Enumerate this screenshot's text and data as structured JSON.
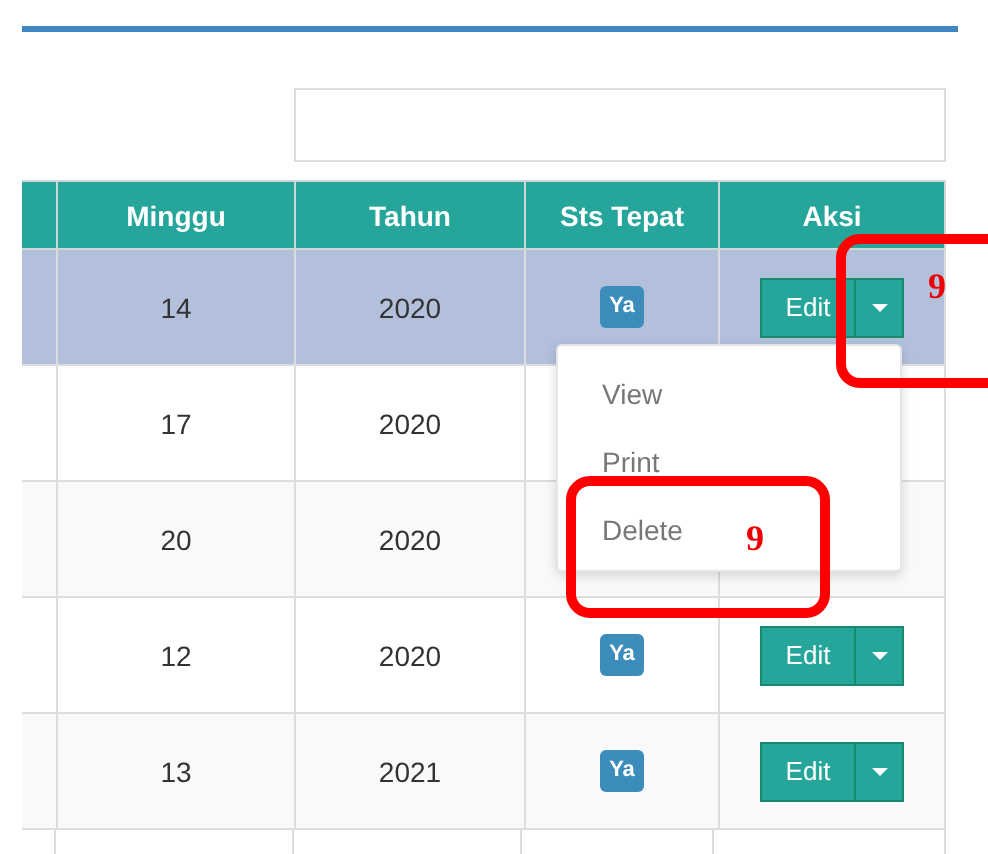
{
  "table": {
    "columns": [
      "Minggu",
      "Tahun",
      "Sts Tepat",
      "Aksi"
    ],
    "rows": [
      {
        "selected": true,
        "week": "14",
        "year": "2020",
        "status": "Ya",
        "action": "Edit"
      },
      {
        "selected": false,
        "week": "17",
        "year": "2020"
      },
      {
        "selected": false,
        "week": "20",
        "year": "2020"
      },
      {
        "selected": false,
        "week": "12",
        "year": "2020",
        "status": "Ya",
        "action": "Edit"
      },
      {
        "selected": false,
        "week": "13",
        "year": "2021",
        "status": "Ya",
        "action": "Edit"
      }
    ]
  },
  "dropdown": {
    "items": [
      "View",
      "Print",
      "Delete"
    ]
  },
  "annotations": [
    {
      "label": "9"
    },
    {
      "label": "9"
    }
  ]
}
